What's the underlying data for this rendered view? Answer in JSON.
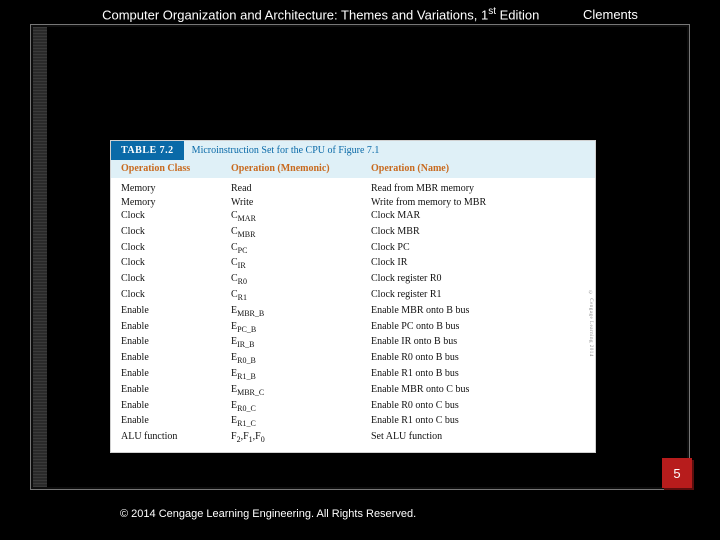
{
  "header": {
    "title_left": "Computer Organization and Architecture: Themes and Variations, 1",
    "title_ord": "st",
    "title_right": " Edition",
    "author": "Clements"
  },
  "table": {
    "tab": "TABLE 7.2",
    "caption": "Microinstruction Set for the CPU of Figure 7.1",
    "columns": [
      "Operation Class",
      "Operation (Mnemonic)",
      "Operation (Name)"
    ],
    "rows": [
      {
        "class": "Memory",
        "mnemonic": "Read",
        "name": "Read from MBR memory"
      },
      {
        "class": "Memory",
        "mnemonic": "Write",
        "name": "Write from memory to MBR"
      },
      {
        "class": "Clock",
        "mnemonic": "C_MAR",
        "name": "Clock MAR"
      },
      {
        "class": "Clock",
        "mnemonic": "C_MBR",
        "name": "Clock MBR"
      },
      {
        "class": "Clock",
        "mnemonic": "C_PC",
        "name": "Clock PC"
      },
      {
        "class": "Clock",
        "mnemonic": "C_IR",
        "name": "Clock IR"
      },
      {
        "class": "Clock",
        "mnemonic": "C_R0",
        "name": "Clock register R0"
      },
      {
        "class": "Clock",
        "mnemonic": "C_R1",
        "name": "Clock register R1"
      },
      {
        "class": "Enable",
        "mnemonic": "E_MBR_B",
        "name": "Enable MBR onto B bus"
      },
      {
        "class": "Enable",
        "mnemonic": "E_PC_B",
        "name": "Enable PC onto B bus"
      },
      {
        "class": "Enable",
        "mnemonic": "E_IR_B",
        "name": "Enable IR onto B bus"
      },
      {
        "class": "Enable",
        "mnemonic": "E_R0_B",
        "name": "Enable R0 onto B bus"
      },
      {
        "class": "Enable",
        "mnemonic": "E_R1_B",
        "name": "Enable R1 onto B bus"
      },
      {
        "class": "Enable",
        "mnemonic": "E_MBR_C",
        "name": "Enable MBR onto C bus"
      },
      {
        "class": "Enable",
        "mnemonic": "E_R0_C",
        "name": "Enable R0 onto C bus"
      },
      {
        "class": "Enable",
        "mnemonic": "E_R1_C",
        "name": "Enable R1 onto C bus"
      },
      {
        "class": "ALU function",
        "mnemonic": "F2F1F0",
        "name": "Set ALU function"
      }
    ],
    "side_attr": "© Cengage Learning 2014"
  },
  "page_number": "5",
  "footer": "© 2014 Cengage Learning Engineering. All Rights Reserved."
}
